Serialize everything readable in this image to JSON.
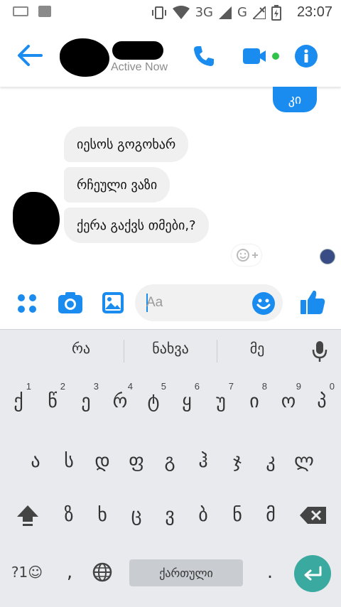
{
  "status_bar": {
    "network": "3G",
    "network2": "G",
    "time": "23:07"
  },
  "header": {
    "status": "Active Now",
    "accent": "#1a8cf0"
  },
  "messages": {
    "sent": "კი",
    "received": [
      "იესოს გოგოხარ",
      "რჩეული ვაზი",
      "ქერა გაქვს თმები,?"
    ]
  },
  "composer": {
    "placeholder": "Aa"
  },
  "keyboard": {
    "suggestions": [
      "რა",
      "ნახვა",
      "მე"
    ],
    "row1": [
      {
        "key": "ქ",
        "hint": "1"
      },
      {
        "key": "წ",
        "hint": "2"
      },
      {
        "key": "ე",
        "hint": "3"
      },
      {
        "key": "რ",
        "hint": "4"
      },
      {
        "key": "ტ",
        "hint": "5"
      },
      {
        "key": "ყ",
        "hint": "6"
      },
      {
        "key": "უ",
        "hint": "7"
      },
      {
        "key": "ი",
        "hint": "8"
      },
      {
        "key": "ო",
        "hint": "9"
      },
      {
        "key": "პ",
        "hint": "0"
      }
    ],
    "row2": [
      "ა",
      "ს",
      "დ",
      "ფ",
      "გ",
      "ჰ",
      "ჯ",
      "კ",
      "ლ"
    ],
    "row3": [
      "ზ",
      "ხ",
      "ც",
      "ვ",
      "ბ",
      "ნ",
      "მ"
    ],
    "symbols_key": "?1☺",
    "comma_key": ",",
    "space_label": "ქართული",
    "period_key": ".",
    "enter_color": "#3aa99f"
  }
}
